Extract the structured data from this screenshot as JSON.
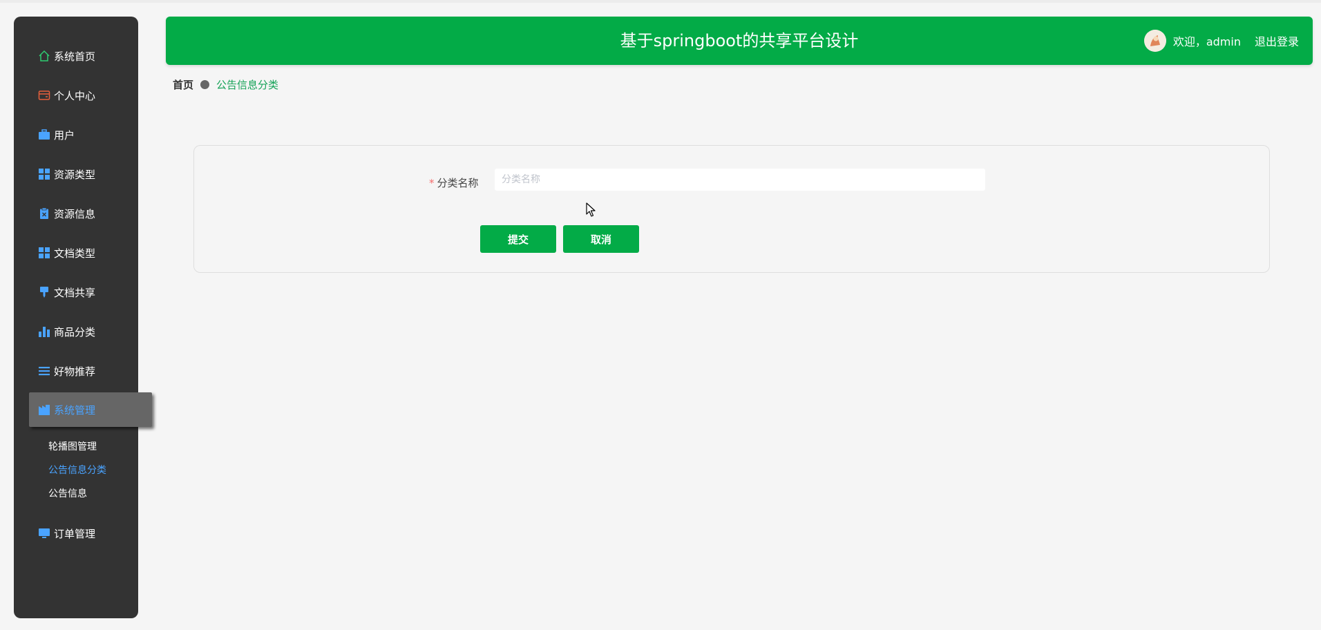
{
  "header": {
    "title": "基于springboot的共享平台设计",
    "welcome": "欢迎，admin",
    "logout": "退出登录"
  },
  "sidebar": {
    "items": [
      {
        "label": "系统首页",
        "icon": "home-icon",
        "color": "#2ecc71"
      },
      {
        "label": "个人中心",
        "icon": "wallet-icon",
        "color": "#e8603c"
      },
      {
        "label": "用户",
        "icon": "briefcase-icon",
        "color": "#4aa3ff"
      },
      {
        "label": "资源类型",
        "icon": "grid-icon",
        "color": "#4aa3ff"
      },
      {
        "label": "资源信息",
        "icon": "clipboard-icon",
        "color": "#4aa3ff"
      },
      {
        "label": "文档类型",
        "icon": "grid-icon",
        "color": "#4aa3ff"
      },
      {
        "label": "文档共享",
        "icon": "brush-icon",
        "color": "#4aa3ff"
      },
      {
        "label": "商品分类",
        "icon": "bar-chart-icon",
        "color": "#4aa3ff"
      },
      {
        "label": "好物推荐",
        "icon": "list-icon",
        "color": "#4aa3ff"
      },
      {
        "label": "系统管理",
        "icon": "building-icon",
        "color": "#4aa3ff"
      },
      {
        "label": "订单管理",
        "icon": "monitor-icon",
        "color": "#4aa3ff"
      }
    ],
    "submenu": [
      "轮播图管理",
      "公告信息分类",
      "公告信息"
    ]
  },
  "breadcrumb": {
    "home": "首页",
    "current": "公告信息分类"
  },
  "form": {
    "label": "分类名称",
    "required_mark": "*",
    "placeholder": "分类名称",
    "value": "",
    "submit": "提交",
    "cancel": "取消"
  },
  "colors": {
    "brand": "#03ab47",
    "sidebar": "#333333",
    "active_text": "#4aa3ff"
  }
}
